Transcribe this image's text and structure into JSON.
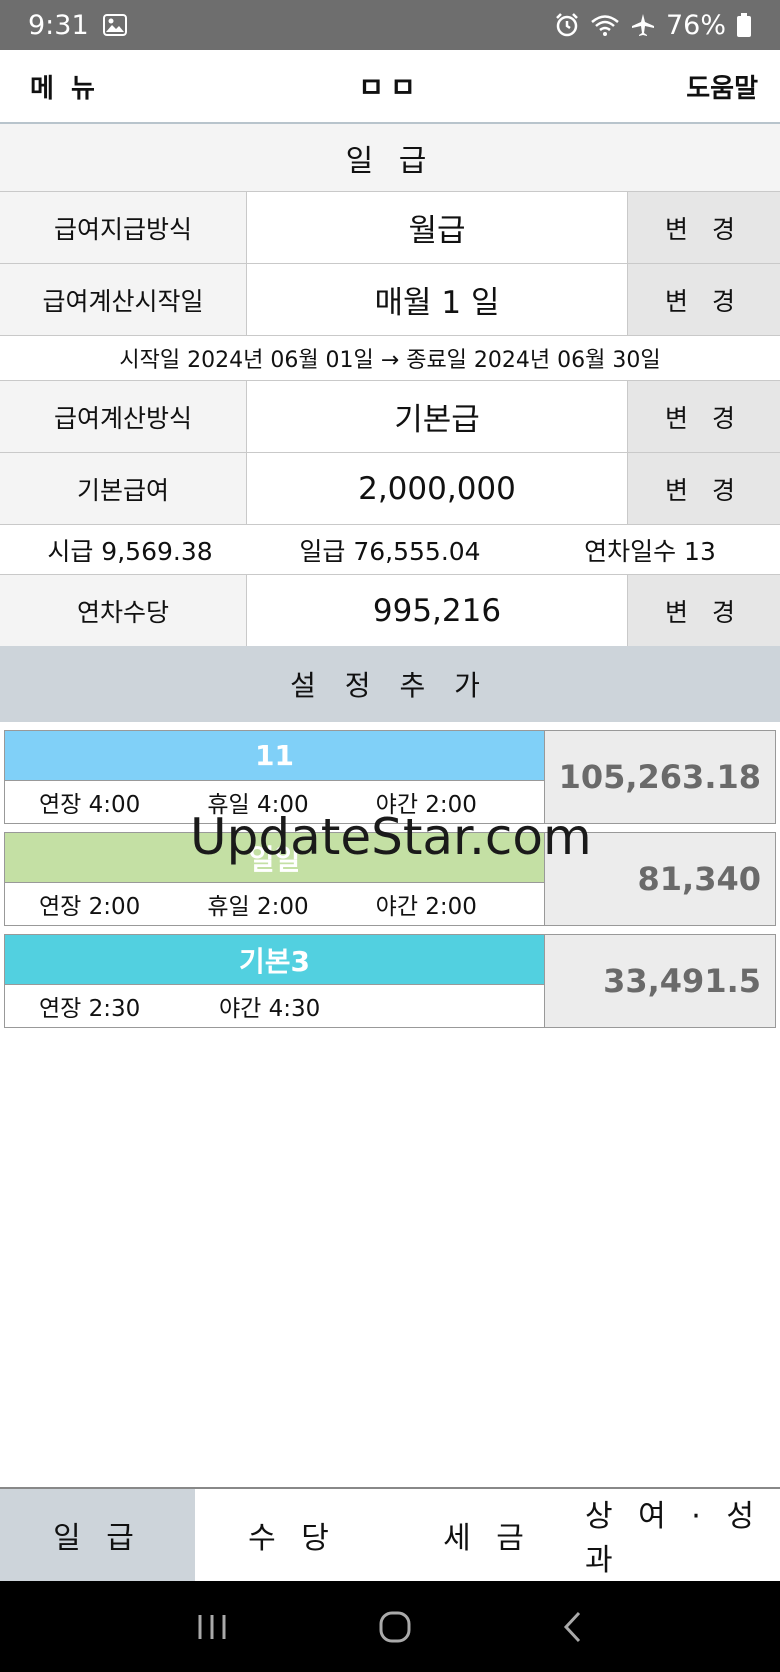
{
  "status": {
    "time": "9:31",
    "battery": "76%"
  },
  "header": {
    "menu": "메 뉴",
    "title": "ㅁㅁ",
    "help": "도움말"
  },
  "section_title": "일 급",
  "rows": {
    "pay_method": {
      "label": "급여지급방식",
      "value": "월급",
      "button": "변 경"
    },
    "calc_start": {
      "label": "급여계산시작일",
      "value": "매월 1 일",
      "button": "변 경"
    },
    "period": "시작일 2024년 06월 01일 → 종료일 2024년 06월 30일",
    "calc_method": {
      "label": "급여계산방식",
      "value": "기본급",
      "button": "변 경"
    },
    "base_pay": {
      "label": "기본급여",
      "value": "2,000,000",
      "button": "변 경"
    },
    "rates": {
      "hourly": "시급 9,569.38",
      "daily": "일급 76,555.04",
      "leave_days": "연차일수 13"
    },
    "annual_allowance": {
      "label": "연차수당",
      "value": "995,216",
      "button": "변 경"
    }
  },
  "add_setting": "설 정 추 가",
  "cards": [
    {
      "name": "11",
      "color": "#80d0f8",
      "items": [
        "연장  4:00",
        "휴일  4:00",
        "야간  2:00"
      ],
      "amount": "105,263.18"
    },
    {
      "name": "일일",
      "color": "#c4e0a4",
      "items": [
        "연장  2:00",
        "휴일  2:00",
        "야간  2:00"
      ],
      "amount": "81,340"
    },
    {
      "name": "기본3",
      "color": "#52d0e0",
      "items": [
        "연장  2:30",
        "야간  4:30"
      ],
      "amount": "33,491.5"
    }
  ],
  "watermark": "UpdateStar.com",
  "tabs": [
    "일 급",
    "수 당",
    "세 금",
    "상 여 · 성 과"
  ],
  "icons": {
    "gallery": "image-icon",
    "alarm": "alarm-icon",
    "wifi": "wifi-icon",
    "airplane": "airplane-icon",
    "battery": "battery-icon",
    "recents": "recents-icon",
    "home": "home-icon",
    "back": "back-icon"
  }
}
